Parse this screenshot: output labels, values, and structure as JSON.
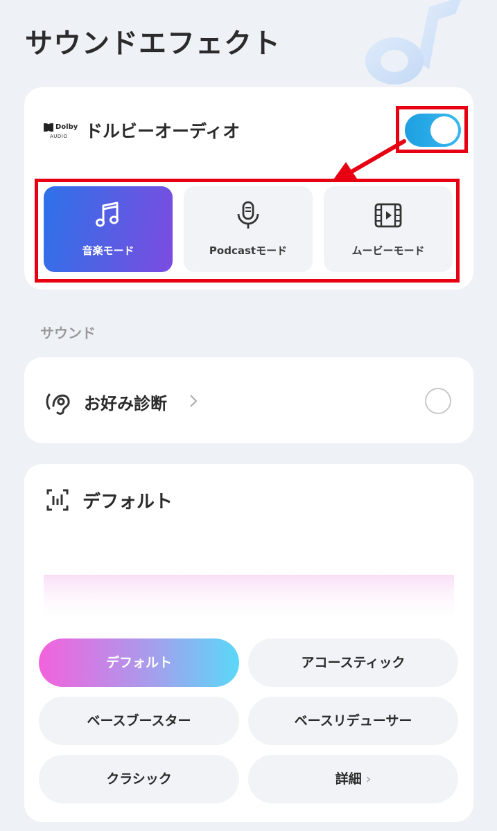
{
  "header": {
    "title": "サウンドエフェクト"
  },
  "dolby": {
    "logo_text": "Dolby",
    "logo_sub": "AUDIO",
    "title": "ドルビーオーディオ",
    "toggle_on": true,
    "modes": [
      {
        "label": "音楽モード",
        "icon": "music-note-icon",
        "active": true
      },
      {
        "label": "Podcastモード",
        "icon": "microphone-icon",
        "active": false
      },
      {
        "label": "ムービーモード",
        "icon": "film-icon",
        "active": false
      }
    ]
  },
  "sound_section": {
    "label": "サウンド"
  },
  "preference": {
    "label": "お好み診断",
    "icon": "ear-icon",
    "selected": false
  },
  "equalizer": {
    "title": "デフォルト",
    "icon": "equalizer-icon",
    "presets": [
      {
        "label": "デフォルト",
        "active": true
      },
      {
        "label": "アコースティック",
        "active": false
      },
      {
        "label": "ベースブースター",
        "active": false
      },
      {
        "label": "ベースリデューサー",
        "active": false
      },
      {
        "label": "クラシック",
        "active": false
      },
      {
        "label": "詳細",
        "active": false,
        "chevron": "›"
      }
    ]
  },
  "colors": {
    "accent_toggle": "#1e9fe0",
    "mode_active_start": "#2d72e8",
    "mode_active_end": "#7c4ce0",
    "highlight_red": "#e60012",
    "preset_gradient": [
      "#f262dc",
      "#a89cec",
      "#5ad8f8"
    ]
  }
}
